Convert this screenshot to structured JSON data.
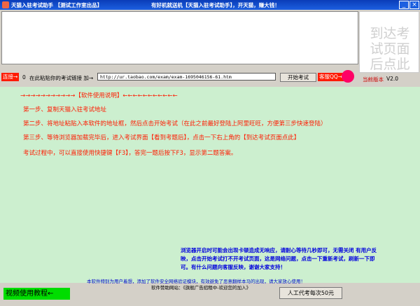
{
  "window": {
    "title_left": "天猫入驻考试助手 【测试工作室出品】",
    "title_center": "有好机就送机【天猫入驻考试助手】，开天猫，赚大钱！",
    "min": "_",
    "close": "×"
  },
  "side_box_text": "到达考\n试页面\n后点此",
  "row": {
    "speed_btn": "连接→",
    "speed_value": "0",
    "paste_label": "在此粘贴你的考试链接 加→",
    "url_value": "http://ur.taobao.com/exam/exam-1695046156-61.htm",
    "start_btn": "开始考试",
    "qq_btn": "客服QQ→",
    "version_label": "当前版本",
    "version_value": "V2.0"
  },
  "instructions": {
    "heading": "→→→→→→→→→→→【软件使用说明】←←←←←←←←←←←",
    "step1": "第一步、复制天猫入驻考试地址",
    "step2": "第二步、将地址粘贴入本软件的地址框，然后点击开始考试（在此之前最好登陆上阿里旺旺，方便第三步快速登陆）",
    "step3": "第三步、等待浏览器加载完毕后，进入考试界面【看到考题后】，点击一下右上角的【到达考试页面点此】",
    "step4": "考试过程中，可以直接使用快捷键【F3】，答完一题后按下F3，显示第二题答案。"
  },
  "notice": {
    "text": "浏览器开启时可能会出现卡顿造成无响应，请耐心等待几秒即可，无需关闭 有用户反映，点击开始考试打不开考试页面，这是网络问题，点击一下重新考试，刷新一下即可。有什么问题向客服反映，谢谢大家支持！"
  },
  "footer": {
    "free_line": "本软件特别为用户着想，添加了软件安全网络验证模块，有效避免了恶意翻样本马的出现，请大家放心使用！",
    "sponsor_line": "软件赞助网站：《旗舰广告招租中-欢迎您的加入》",
    "video_btn": "视频使用教程←",
    "manual_btn": "人工代考每次50元"
  }
}
